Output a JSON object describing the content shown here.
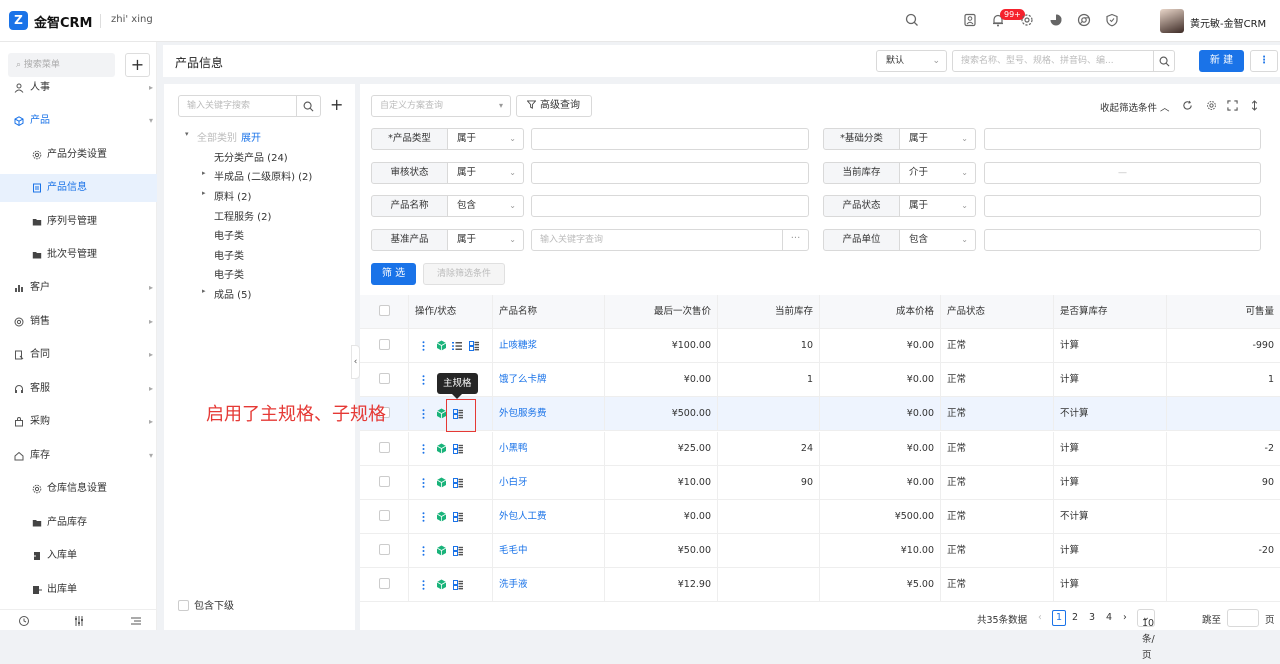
{
  "app": {
    "title": "金智CRM",
    "workspace": "zhi' xing",
    "logo_letter": "Z"
  },
  "topbar": {
    "notification_badge": "99+",
    "user_name": "黄元敏-金智CRM",
    "icons": [
      "search-icon",
      "contacts-icon",
      "bell-icon",
      "gear-icon",
      "pie-chart-icon",
      "chrome-icon",
      "shield-icon"
    ]
  },
  "sidebar": {
    "search_placeholder": "搜索菜单",
    "add_label": "+",
    "items": [
      {
        "label": "人事",
        "icon": "people-icon"
      },
      {
        "label": "产品",
        "icon": "cube-icon"
      },
      {
        "label": "产品分类设置",
        "icon": "gear-icon"
      },
      {
        "label": "产品信息",
        "icon": "document-icon"
      },
      {
        "label": "序列号管理",
        "icon": "folder-icon"
      },
      {
        "label": "批次号管理",
        "icon": "folder-icon"
      },
      {
        "label": "客户",
        "icon": "bar-chart-icon"
      },
      {
        "label": "销售",
        "icon": "target-icon"
      },
      {
        "label": "合同",
        "icon": "contract-icon"
      },
      {
        "label": "客服",
        "icon": "headset-icon"
      },
      {
        "label": "采购",
        "icon": "bag-icon"
      },
      {
        "label": "库存",
        "icon": "home-icon"
      },
      {
        "label": "仓库信息设置",
        "icon": "gear-icon"
      },
      {
        "label": "产品库存",
        "icon": "folder-icon"
      },
      {
        "label": "入库单",
        "icon": "inbound-icon"
      },
      {
        "label": "出库单",
        "icon": "outbound-icon"
      }
    ]
  },
  "header": {
    "page_title": "产品信息",
    "view_select": "默认",
    "search_placeholder": "搜索名称、型号、规格、拼音码、编...",
    "new_button": "新 建",
    "more_button": "⋮"
  },
  "tree": {
    "search_placeholder": "输入关键字搜索",
    "root_label": "全部类别",
    "expand_link": "展开",
    "nodes": [
      "无分类产品 (24)",
      "半成品 (二级原料) (2)",
      "原料 (2)",
      "工程服务 (2)",
      "电子类",
      "电子类",
      "电子类",
      "成品 (5)"
    ],
    "include_sub": "包含下级"
  },
  "filters": {
    "scheme_placeholder": "自定义方案查询",
    "advanced_button": "高级查询",
    "collapse_label": "收起筛选条件",
    "rows": [
      {
        "label": "*产品类型",
        "op": "属于",
        "label2": "*基础分类",
        "op2": "属于"
      },
      {
        "label": "审核状态",
        "op": "属于",
        "label2": "当前库存",
        "op2": "介于",
        "range_sep": "—"
      },
      {
        "label": "产品名称",
        "op": "包含",
        "label2": "产品状态",
        "op2": "属于"
      },
      {
        "label": "基准产品",
        "op": "属于",
        "placeholder": "输入关键字查询",
        "label2": "产品单位",
        "op2": "包含"
      }
    ],
    "filter_button": "筛 选",
    "clear_button": "清除筛选条件"
  },
  "table": {
    "headers": [
      "操作/状态",
      "产品名称",
      "最后一次售价",
      "当前库存",
      "成本价格",
      "产品状态",
      "是否算库存",
      "可售量"
    ],
    "rows": [
      {
        "name": "止咳糖浆",
        "last_price": "¥100.00",
        "stock": "10",
        "cost": "¥0.00",
        "status": "正常",
        "count_stock": "计算",
        "sellable": "-990"
      },
      {
        "name": "饿了么卡牌",
        "last_price": "¥0.00",
        "stock": "1",
        "cost": "¥0.00",
        "status": "正常",
        "count_stock": "计算",
        "sellable": "1"
      },
      {
        "name": "外包服务费",
        "last_price": "¥500.00",
        "stock": "",
        "cost": "¥0.00",
        "status": "正常",
        "count_stock": "不计算",
        "sellable": ""
      },
      {
        "name": "小黑鸭",
        "last_price": "¥25.00",
        "stock": "24",
        "cost": "¥0.00",
        "status": "正常",
        "count_stock": "计算",
        "sellable": "-2"
      },
      {
        "name": "小白牙",
        "last_price": "¥10.00",
        "stock": "90",
        "cost": "¥0.00",
        "status": "正常",
        "count_stock": "计算",
        "sellable": "90"
      },
      {
        "name": "外包人工费",
        "last_price": "¥0.00",
        "stock": "",
        "cost": "¥500.00",
        "status": "正常",
        "count_stock": "不计算",
        "sellable": ""
      },
      {
        "name": "毛毛中",
        "last_price": "¥50.00",
        "stock": "",
        "cost": "¥10.00",
        "status": "正常",
        "count_stock": "计算",
        "sellable": "-20"
      },
      {
        "name": "洗手液",
        "last_price": "¥12.90",
        "stock": "",
        "cost": "¥5.00",
        "status": "正常",
        "count_stock": "计算",
        "sellable": ""
      }
    ]
  },
  "tooltip": "主规格",
  "annotation": "启用了主规格、子规格",
  "pagination": {
    "total": "共35条数据",
    "pages": [
      "1",
      "2",
      "3",
      "4"
    ],
    "page_size": "10 条/页",
    "jump_label": "跳至",
    "page_unit": "页"
  },
  "colors": {
    "accent": "#1a73e8",
    "cube_green": "#19b37a",
    "annotation_red": "#e53935"
  }
}
